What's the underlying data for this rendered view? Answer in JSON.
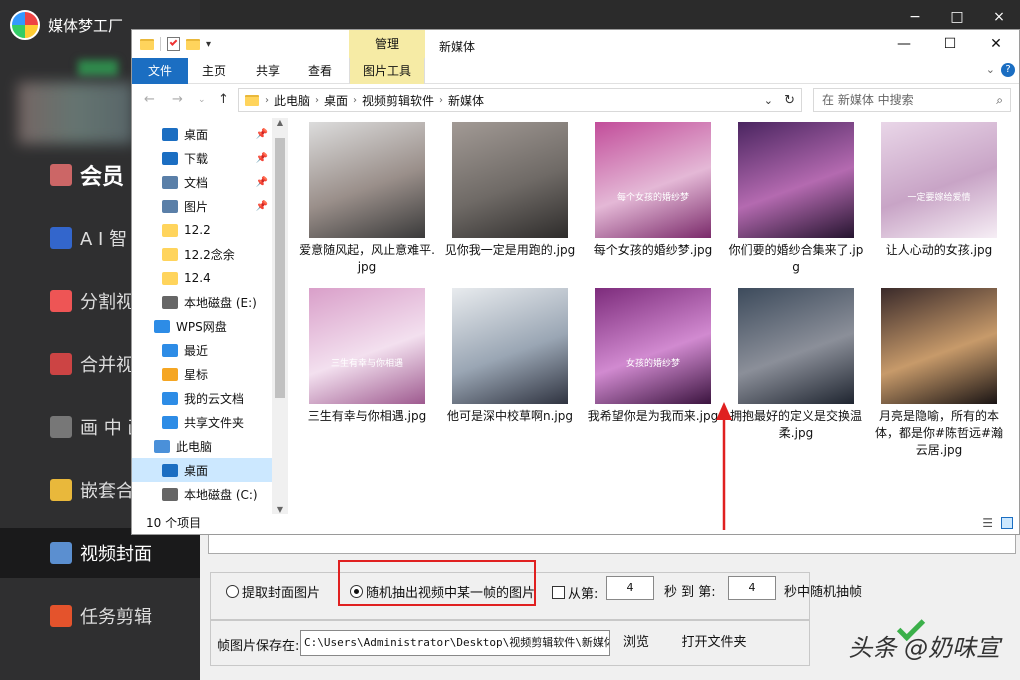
{
  "app": {
    "title": "媒体梦工厂",
    "window_controls": [
      "−",
      "□",
      "×"
    ]
  },
  "sidebar": {
    "items": [
      {
        "label": "会员",
        "icon": "vip-user-icon"
      },
      {
        "label": "A I 智",
        "icon": "ai-icon"
      },
      {
        "label": "分割视",
        "icon": "split-video-icon"
      },
      {
        "label": "合并视",
        "icon": "merge-video-icon"
      },
      {
        "label": "画 中 画",
        "icon": "picture-in-picture-icon"
      },
      {
        "label": "嵌套合",
        "icon": "nested-merge-icon"
      },
      {
        "label": "视频封面",
        "icon": "video-cover-icon",
        "active": true
      },
      {
        "label": "任务剪辑",
        "icon": "task-edit-icon"
      }
    ]
  },
  "explorer": {
    "title": "新媒体",
    "quick_access_dropdown": "▾",
    "manage_tab": "管理",
    "ribbon_tabs": [
      "文件",
      "主页",
      "共享",
      "查看",
      "图片工具"
    ],
    "address": [
      "此电脑",
      "桌面",
      "视频剪辑软件",
      "新媒体"
    ],
    "search_placeholder": "在 新媒体 中搜索",
    "nav_items": [
      {
        "label": "桌面",
        "pinned": true
      },
      {
        "label": "下载",
        "pinned": true
      },
      {
        "label": "文档",
        "pinned": true
      },
      {
        "label": "图片",
        "pinned": true
      },
      {
        "label": "12.2"
      },
      {
        "label": "12.2念余"
      },
      {
        "label": "12.4"
      },
      {
        "label": "本地磁盘 (E:)"
      },
      {
        "label": "WPS网盘"
      },
      {
        "label": "最近"
      },
      {
        "label": "星标"
      },
      {
        "label": "我的云文档"
      },
      {
        "label": "共享文件夹"
      },
      {
        "label": "此电脑"
      },
      {
        "label": "桌面",
        "selected": true
      },
      {
        "label": "本地磁盘 (C:)"
      }
    ],
    "files": [
      {
        "name": "爱意随风起，风止意难平.jpg",
        "colors": [
          "#dcdcdc",
          "#9a8f8a",
          "#3a3a3a"
        ]
      },
      {
        "name": "见你我一定是用跑的.jpg",
        "colors": [
          "#a29a95",
          "#6f6a66",
          "#2e2c2b"
        ]
      },
      {
        "name": "每个女孩的婚纱梦.jpg",
        "colors": [
          "#c24d9a",
          "#e4b8d6",
          "#7a2a6a"
        ],
        "overlay": "每个女孩的婚纱梦"
      },
      {
        "name": "你们要的婚纱合集来了.jpg",
        "colors": [
          "#4a2560",
          "#b46ab0",
          "#25142f"
        ]
      },
      {
        "name": "让人心动的女孩.jpg",
        "colors": [
          "#e9d6e8",
          "#c8a4c6",
          "#f6eef5"
        ],
        "overlay": "一定要嫁给爱情"
      },
      {
        "name": "三生有幸与你相遇.jpg",
        "colors": [
          "#d99fc9",
          "#f3e0ef",
          "#9e5a8f"
        ],
        "overlay": "三生有幸与你相遇"
      },
      {
        "name": "他可是深中校草啊n.jpg",
        "colors": [
          "#e8ebee",
          "#9aa6b4",
          "#2f3340"
        ]
      },
      {
        "name": "我希望你是为我而来.jpg",
        "colors": [
          "#7d2c7c",
          "#d18ad0",
          "#3b143f"
        ],
        "overlay": "女孩的婚纱梦"
      },
      {
        "name": "拥抱最好的定义是交换温柔.jpg",
        "colors": [
          "#3d4b5c",
          "#8b8f99",
          "#1f2530"
        ]
      },
      {
        "name": "月亮是隐喻，所有的本体，都是你#陈哲远#瀚云居.jpg",
        "colors": [
          "#3a2a2a",
          "#c79a6a",
          "#1a1414"
        ]
      }
    ],
    "status": "10 个项目"
  },
  "options": {
    "radio_extract": "提取封面图片",
    "radio_random": "随机抽出视频中某一帧的图片",
    "checkbox_from": "从第:",
    "from_value": "4",
    "to_label": "秒 到 第:",
    "to_value": "4",
    "tail_label": "秒中随机抽帧",
    "save_label": "帧图片保存在:",
    "save_path": "C:\\Users\\Administrator\\Desktop\\视频剪辑软件\\新媒体",
    "browse": "浏览",
    "open_folder": "打开文件夹",
    "watermark": "头条 @奶味宣"
  },
  "colors": {
    "accent": "#1b6ec2",
    "highlight_box": "#e02020",
    "tools_tab": "#f6eba5"
  }
}
